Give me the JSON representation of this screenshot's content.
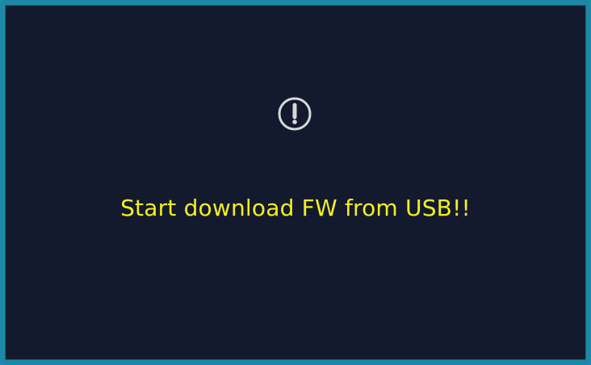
{
  "dialog": {
    "icon": "exclamation-circle-icon",
    "message": "Start download FW from USB!!",
    "colors": {
      "border": "#1d87a6",
      "background": "#131a2e",
      "message_text": "#f5ef1f",
      "icon": "#d8d8d8"
    }
  }
}
